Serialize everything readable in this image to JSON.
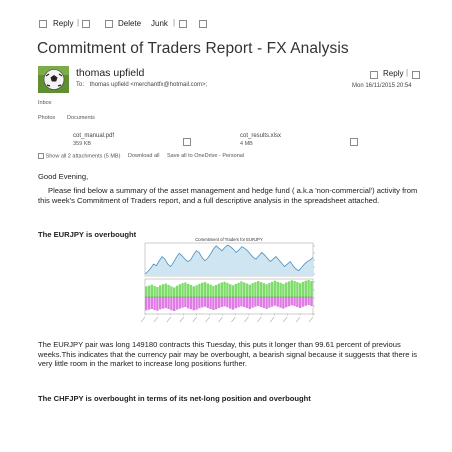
{
  "toolbar": {
    "reply_label": "Reply",
    "delete_label": "Delete",
    "junk_label": "Junk"
  },
  "email": {
    "subject": "Commitment of Traders Report - FX Analysis",
    "sender_name": "thomas upfield",
    "to_label": "To:",
    "to_address": "thomas upfield <merchantfx@hotmail.com>;",
    "reply_label": "Reply",
    "date": "Mon 16/11/2015 20:54",
    "folder": "Inbox",
    "tabs": [
      "Photos",
      "Documents"
    ],
    "attachments": [
      {
        "name": "cot_manual.pdf",
        "size": "359 KB"
      },
      {
        "name": "cot_results.xlsx",
        "size": "4 MB"
      }
    ],
    "attachment_actions": {
      "show_all": "Show all 2 attachments (5 MB)",
      "download_all": "Download all",
      "save_onedrive": "Save all to OneDrive - Personal"
    },
    "greeting": "Good Evening,",
    "intro": "Please find below a summary of the asset management and hedge fund ( a.k.a 'non-commercial') activity from this week's Commitment of Traders report, and a full descriptive analysis in the spreadsheet attached.",
    "section1_heading": "The EURJPY is overbought",
    "section1_body": "The EURJPY pair was long 149180 contracts this Tuesday, this puts it longer than 99.61 percent of previous weeks.This indicates that the currency pair may be overbought, a bearish signal because it suggests that there is very little room in the market to increase long positions further.",
    "section2_heading": "The CHFJPY is overbought in terms of its net-long position and overbought"
  },
  "colors": {
    "price_line": "#4a8fc0",
    "price_fill": "#cfe6f2",
    "position_bars": "#7ddc6a",
    "negative_bars": "#e07ae6",
    "toolbar_icon": "#8a8a8a"
  },
  "icons": {
    "avatar": "soccer-ball-avatar",
    "attachment_pdf": "pdf-file-icon",
    "attachment_xlsx": "excel-file-icon"
  },
  "chart_data": {
    "type": "line",
    "title": "Commitment of Traders for EURJPY",
    "price_series": {
      "values": [
        40,
        43,
        47,
        52,
        50,
        56,
        61,
        58,
        52,
        49,
        54,
        60,
        65,
        62,
        58,
        55,
        57,
        63,
        68,
        66,
        60,
        56,
        59,
        64,
        70,
        74,
        71,
        68,
        72,
        75,
        73,
        70,
        66,
        69,
        73,
        71,
        68,
        64,
        60,
        58,
        62,
        66,
        63,
        59,
        55,
        58,
        61,
        57,
        53,
        49,
        52,
        55,
        50,
        46,
        44,
        48,
        52,
        55,
        57,
        60
      ]
    },
    "position_series": {
      "values": [
        30,
        32,
        35,
        31,
        28,
        33,
        36,
        38,
        34,
        30,
        27,
        32,
        36,
        39,
        41,
        37,
        34,
        30,
        33,
        37,
        40,
        42,
        38,
        35,
        31,
        34,
        38,
        41,
        43,
        40,
        36,
        33,
        37,
        40,
        44,
        41,
        38,
        35,
        39,
        42,
        45,
        42,
        39,
        36,
        40,
        43,
        46,
        43,
        40,
        37,
        41,
        44,
        47,
        45,
        42,
        39,
        43,
        46,
        48,
        45
      ]
    },
    "negative_series": {
      "values": [
        -40,
        -38,
        -36,
        -39,
        -41,
        -37,
        -35,
        -33,
        -36,
        -40,
        -42,
        -38,
        -35,
        -32,
        -30,
        -34,
        -37,
        -40,
        -38,
        -34,
        -31,
        -29,
        -33,
        -36,
        -39,
        -37,
        -33,
        -30,
        -28,
        -31,
        -35,
        -38,
        -34,
        -31,
        -28,
        -30,
        -33,
        -36,
        -32,
        -29,
        -27,
        -30,
        -33,
        -36,
        -32,
        -29,
        -26,
        -29,
        -32,
        -35,
        -31,
        -28,
        -25,
        -27,
        -30,
        -33,
        -29,
        -26,
        -24,
        -27
      ]
    },
    "x_tick_labels": [
      "",
      "",
      "",
      "",
      "",
      "",
      "",
      "",
      "",
      "",
      "",
      "",
      "",
      ""
    ]
  }
}
